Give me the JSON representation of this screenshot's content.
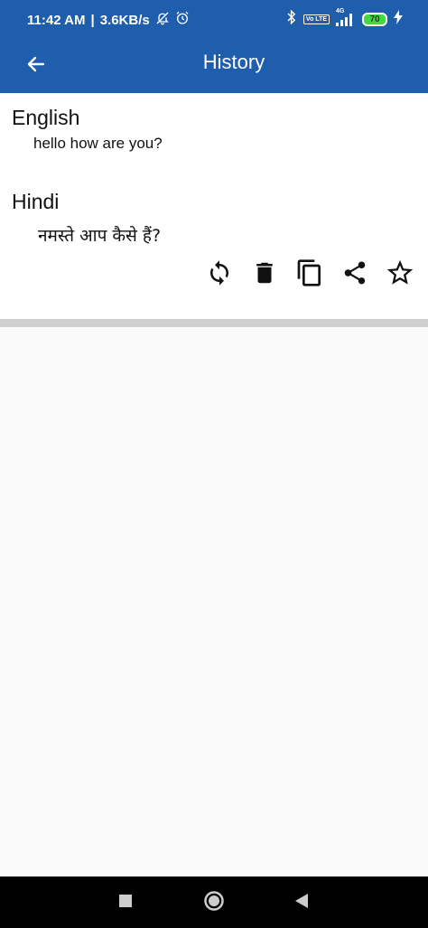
{
  "status_bar": {
    "time": "11:42 AM",
    "speed": "3.6KB/s",
    "network_badge": "Vo LTE",
    "network_type": "4G",
    "battery": "70"
  },
  "app_bar": {
    "title": "History"
  },
  "history_item": {
    "source_language": "English",
    "source_text": "hello how are you?",
    "target_language": "Hindi",
    "target_text": "नमस्ते आप कैसे हैं?"
  },
  "actions": [
    {
      "name": "refresh"
    },
    {
      "name": "delete"
    },
    {
      "name": "copy"
    },
    {
      "name": "share"
    },
    {
      "name": "favorite"
    }
  ],
  "colors": {
    "primary": "#1e5ead",
    "battery": "#43d843"
  }
}
